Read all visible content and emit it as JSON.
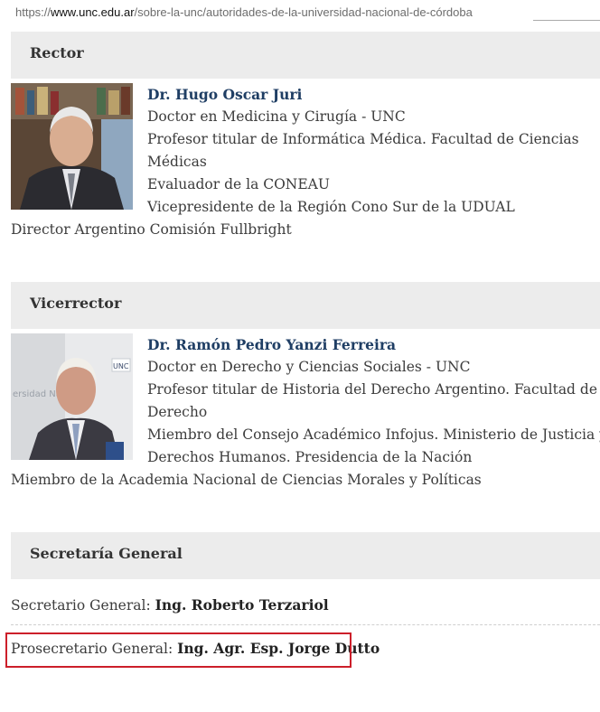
{
  "browser": {
    "url_scheme": "https://",
    "url_host": "www.unc.edu.ar",
    "url_path": "/sobre-la-unc/autoridades-de-la-universidad-nacional-de-córdoba"
  },
  "sections": {
    "rector": {
      "heading": "Rector",
      "name": "Dr. Hugo Oscar Juri",
      "lines": [
        "Doctor en Medicina y Cirugía - UNC",
        "Profesor titular de Informática Médica. Facultad de Ciencias",
        "Médicas",
        "Evaluador de la CONEAU",
        "Vicepresidente de la Región Cono Sur de la UDUAL"
      ],
      "last_line": "Director Argentino Comisión Fullbright"
    },
    "vicerrector": {
      "heading": "Vicerrector",
      "name": "Dr. Ramón Pedro Yanzi Ferreira",
      "lines": [
        "Doctor en Derecho y Ciencias Sociales - UNC",
        "Profesor titular de Historia del Derecho Argentino. Facultad de",
        "Derecho",
        "Miembro del Consejo Académico Infojus. Ministerio de Justicia y",
        "Derechos Humanos. Presidencia de la Nación"
      ],
      "last_line": "Miembro de la Academia Nacional de Ciencias Morales y Políticas"
    },
    "secretaria": {
      "heading": "Secretaría General",
      "secretario_label": "Secretario General:",
      "secretario_name": "Ing. Roberto Terzariol",
      "prosecretario_label": "Prosecretario General:",
      "prosecretario_name": "Ing. Agr. Esp. Jorge Dutto"
    }
  },
  "colors": {
    "header_bg": "#ececec",
    "name_color": "#1f3e64",
    "highlight_border": "#cc1f2a"
  }
}
